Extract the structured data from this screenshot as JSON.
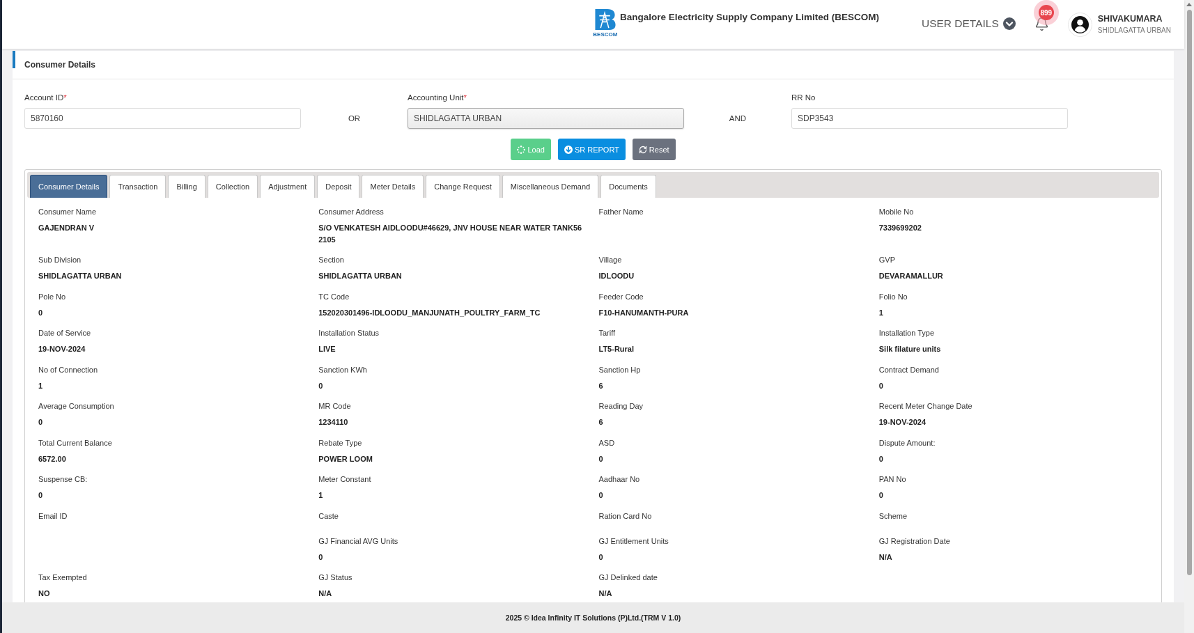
{
  "header": {
    "logo_caption": "BESCOM",
    "title": "Bangalore Electricity Supply Company Limited (BESCOM)",
    "user_menu": "USER DETAILS",
    "notification_count": "899",
    "user": {
      "name": "SHIVAKUMARA",
      "office": "SHIDLAGATTA URBAN"
    }
  },
  "card": {
    "title": "Consumer Details"
  },
  "search": {
    "items": [
      {
        "kind": "input",
        "label": "Account ID",
        "required_mark": "*",
        "value": "5870160"
      },
      {
        "kind": "connector",
        "text": "OR"
      },
      {
        "kind": "select",
        "label": "Accounting Unit",
        "required_mark": "*",
        "value": "SHIDLAGATTA URBAN"
      },
      {
        "kind": "connector",
        "text": "AND"
      },
      {
        "kind": "input",
        "label": "RR No",
        "value": "SDP3543"
      }
    ],
    "buttons": [
      {
        "kind": "load",
        "label": "Load",
        "disabled": true
      },
      {
        "kind": "report",
        "label": "SR REPORT",
        "disabled": false
      },
      {
        "kind": "reset",
        "label": "Reset",
        "disabled": false
      }
    ]
  },
  "tabs": [
    {
      "label": "Consumer Details",
      "selected": true
    },
    {
      "label": "Transaction",
      "selected": false
    },
    {
      "label": "Billing",
      "selected": false
    },
    {
      "label": "Collection",
      "selected": false
    },
    {
      "label": "Adjustment",
      "selected": false
    },
    {
      "label": "Deposit",
      "selected": false
    },
    {
      "label": "Meter Details",
      "selected": false
    },
    {
      "label": "Change Request",
      "selected": false
    },
    {
      "label": "Miscellaneous Demand",
      "selected": false
    },
    {
      "label": "Documents",
      "selected": false
    }
  ],
  "details": {
    "rows": [
      [
        {
          "label": "Consumer Name",
          "value": "GAJENDRAN V"
        },
        {
          "label": "Consumer Address",
          "value": "S/O VENKATESH AIDLOODU#46629, JNV HOUSE NEAR WATER TANK562105"
        },
        {
          "label": "Father Name"
        },
        {
          "label": "Mobile No",
          "value": "7339699202"
        }
      ],
      [
        {
          "label": "Sub Division",
          "value": "SHIDLAGATTA URBAN"
        },
        {
          "label": "Section",
          "value": "SHIDLAGATTA URBAN"
        },
        {
          "label": "Village",
          "value": "IDLOODU"
        },
        {
          "label": "GVP",
          "value": "DEVARAMALLUR"
        }
      ],
      [
        {
          "label": "Pole No",
          "value": "0"
        },
        {
          "label": "TC Code",
          "value": "152020301496-IDLOODU_MANJUNATH_POULTRY_FARM_TC"
        },
        {
          "label": "Feeder Code",
          "value": "F10-HANUMANTH-PURA"
        },
        {
          "label": "Folio No",
          "value": "1"
        }
      ],
      [
        {
          "label": "Date of Service",
          "value": "19-NOV-2024"
        },
        {
          "label": "Installation Status",
          "value": "LIVE"
        },
        {
          "label": "Tariff",
          "value": "LT5-Rural"
        },
        {
          "label": "Installation Type",
          "value": "Silk filature units"
        }
      ],
      [
        {
          "label": "No of Connection",
          "value": "1"
        },
        {
          "label": "Sanction KWh",
          "value": "0"
        },
        {
          "label": "Sanction Hp",
          "value": "6"
        },
        {
          "label": "Contract Demand",
          "value": "0"
        }
      ],
      [
        {
          "label": "Average Consumption",
          "value": "0"
        },
        {
          "label": "MR Code",
          "value": "1234110"
        },
        {
          "label": "Reading Day",
          "value": "6"
        },
        {
          "label": "Recent Meter Change Date",
          "value": "19-NOV-2024"
        }
      ],
      [
        {
          "label": "Total Current Balance",
          "value": "6572.00"
        },
        {
          "label": "Rebate Type",
          "value": "POWER LOOM"
        },
        {
          "label": "ASD",
          "value": "0"
        },
        {
          "label": "Dispute Amount:",
          "value": "0"
        }
      ],
      [
        {
          "label": "Suspense CB:",
          "value": "0"
        },
        {
          "label": "Meter Constant",
          "value": "1"
        },
        {
          "label": "Aadhaar No",
          "value": "0"
        },
        {
          "label": "PAN No",
          "value": "0"
        }
      ],
      [
        {
          "label": "Email ID"
        },
        {
          "label": "Caste"
        },
        {
          "label": "Ration Card No"
        },
        {
          "label": "Scheme"
        }
      ],
      [
        null,
        {
          "label": "GJ Financial AVG Units",
          "value": "0"
        },
        {
          "label": "GJ Entitlement Units",
          "value": "0"
        },
        {
          "label": "GJ Registration Date",
          "value": "N/A"
        }
      ],
      [
        {
          "label": "Tax Exempted",
          "value": "NO"
        },
        {
          "label": "GJ Status",
          "value": "N/A"
        },
        {
          "label": "GJ Delinked date",
          "value": "N/A"
        }
      ]
    ]
  },
  "footer": {
    "text": "2025 © Idea Infinity IT Solutions (P)Ltd.(TRM V 1.0)"
  }
}
